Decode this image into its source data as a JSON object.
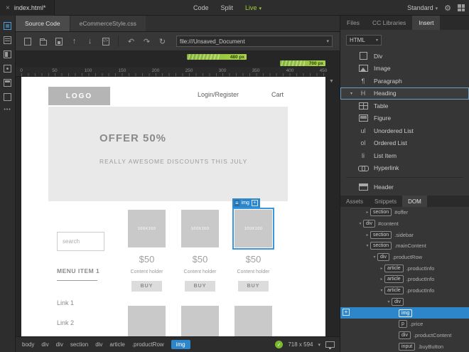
{
  "icons": {
    "close": "×",
    "caret_down": "▾",
    "tri_down": "▼",
    "upload": "↑",
    "download": "↓",
    "undo": "↶",
    "redo": "↷",
    "refresh": "↻",
    "gear": "⚙",
    "check": "✓",
    "plus": "+",
    "menu": "≡",
    "dots": "•••"
  },
  "topbar": {
    "doc_tab": "index.html*",
    "modes": [
      "Code",
      "Split",
      "Live"
    ],
    "active_mode": "Live",
    "workspace": "Standard"
  },
  "doc_tabs": {
    "source": "Source Code",
    "related": "eCommerceStyle.css"
  },
  "toolbar": {
    "url": "file:///Unsaved_Document"
  },
  "media_queries": [
    {
      "label": "480 px"
    },
    {
      "label": "700 px"
    }
  ],
  "ruler": {
    "ticks": [
      "0",
      "50",
      "100",
      "150",
      "200",
      "250",
      "300",
      "350",
      "400",
      "450"
    ]
  },
  "page": {
    "logo": "LOGO",
    "nav_login": "Login/Register",
    "nav_cart": "Cart",
    "hero_title": "OFFER 50%",
    "hero_subtitle": "REALLY AWESOME DISCOUNTS THIS JULY",
    "search_placeholder": "search",
    "menu_title": "MENU ITEM 1",
    "links": [
      "Link 1",
      "Link 2"
    ],
    "products": [
      {
        "image_label": "100X100",
        "price": "$50",
        "caption": "Content holder",
        "buy": "BUY"
      },
      {
        "image_label": "100X100",
        "price": "$50",
        "caption": "Content holder",
        "buy": "BUY"
      },
      {
        "image_label": "100X100",
        "price": "$50",
        "caption": "Content holder",
        "buy": "BUY"
      }
    ],
    "selection_label": "img"
  },
  "insert_panel": {
    "tabs": [
      "Files",
      "CC Libraries",
      "Insert"
    ],
    "active_tab": "Insert",
    "category": "HTML",
    "items": [
      {
        "label": "Div"
      },
      {
        "label": "Image"
      },
      {
        "label": "Paragraph",
        "glyph": "¶"
      },
      {
        "label": "Heading",
        "glyph": "H"
      },
      {
        "label": "Table"
      },
      {
        "label": "Figure"
      },
      {
        "label": "Unordered List",
        "glyph": "ul"
      },
      {
        "label": "Ordered List",
        "glyph": "ol"
      },
      {
        "label": "List Item",
        "glyph": "li"
      },
      {
        "label": "Hyperlink"
      },
      {
        "label": "Header"
      }
    ]
  },
  "dom_panel": {
    "tabs": [
      "Assets",
      "Snippets",
      "DOM"
    ],
    "active_tab": "DOM",
    "rows": [
      {
        "tag": "section",
        "selector": "#offer"
      },
      {
        "tag": "div",
        "selector": "#content"
      },
      {
        "tag": "section",
        "selector": ".sidebar"
      },
      {
        "tag": "section",
        "selector": ".mainContent"
      },
      {
        "tag": "div",
        "selector": ".productRow"
      },
      {
        "tag": "article",
        "selector": ".productInfo"
      },
      {
        "tag": "article",
        "selector": ".productInfo"
      },
      {
        "tag": "article",
        "selector": ".productInfo"
      },
      {
        "tag": "div",
        "selector": ""
      },
      {
        "tag": "img",
        "selector": ""
      },
      {
        "tag": "p",
        "selector": ".price"
      },
      {
        "tag": "div",
        "selector": ".productContent"
      },
      {
        "tag": "input",
        "selector": ".buyButton"
      }
    ]
  },
  "statusbar": {
    "tags": [
      "body",
      "div",
      "div",
      "section",
      "div",
      "article",
      ".productRow",
      "img"
    ],
    "active_tag": "img",
    "size": "718 x 594"
  }
}
